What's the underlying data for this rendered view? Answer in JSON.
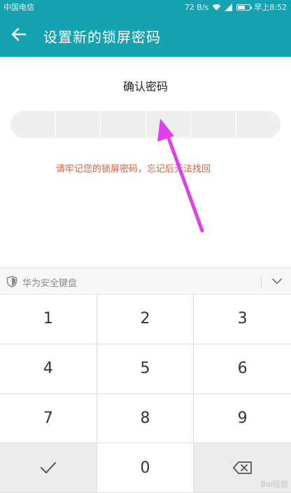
{
  "status_bar": {
    "carrier": "中国电信",
    "speed": "72 B/s",
    "time": "早上8:52",
    "battery_level": 0.6
  },
  "app_bar": {
    "title": "设置新的锁屏密码",
    "back_icon": "arrow-left-icon"
  },
  "main": {
    "confirm_title": "确认密码",
    "pin_length": 6,
    "warning": "请牢记您的锁屏密码，忘记后无法找回",
    "arrow_color": "#e040e8"
  },
  "keyboard": {
    "name": "华为安全键盘",
    "keys": [
      "1",
      "2",
      "3",
      "4",
      "5",
      "6",
      "7",
      "8",
      "9",
      "",
      "0",
      ""
    ],
    "confirm_icon": "checkmark-icon",
    "delete_icon": "backspace-icon",
    "watermark": "Bai经验"
  },
  "colors": {
    "accent": "#16a3b1",
    "warning": "#e8573c",
    "key_gray": "#ebebeb"
  }
}
